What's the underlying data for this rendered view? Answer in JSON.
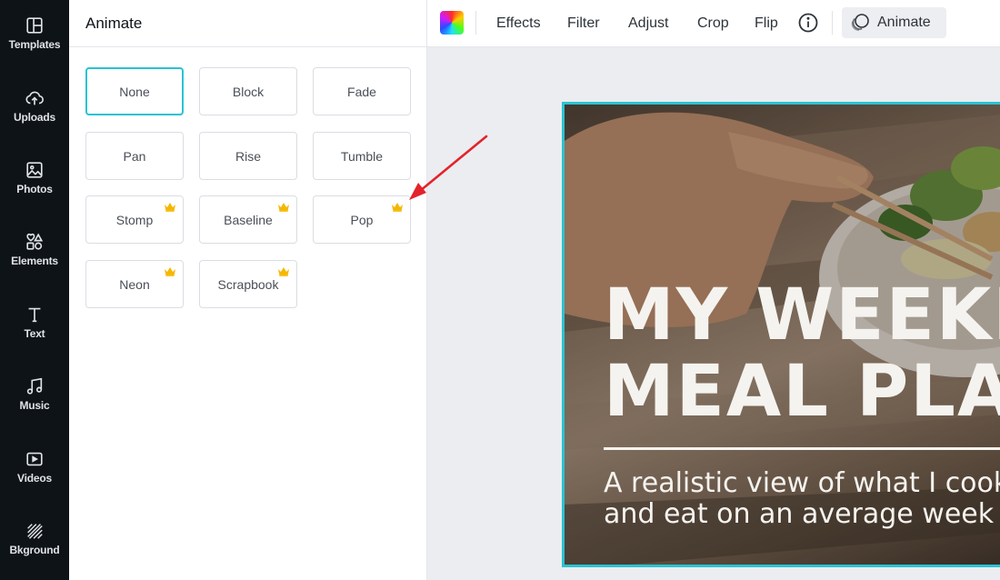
{
  "sidebar": {
    "items": [
      {
        "label": "Templates",
        "icon": "templates-icon"
      },
      {
        "label": "Uploads",
        "icon": "upload-cloud-icon"
      },
      {
        "label": "Photos",
        "icon": "image-icon"
      },
      {
        "label": "Elements",
        "icon": "shapes-icon"
      },
      {
        "label": "Text",
        "icon": "text-t-icon"
      },
      {
        "label": "Music",
        "icon": "music-note-icon"
      },
      {
        "label": "Videos",
        "icon": "video-play-icon"
      },
      {
        "label": "Bkground",
        "icon": "background-hatch-icon"
      }
    ]
  },
  "panel": {
    "title": "Animate",
    "animations": [
      {
        "label": "None",
        "selected": true,
        "premium": false
      },
      {
        "label": "Block",
        "selected": false,
        "premium": false
      },
      {
        "label": "Fade",
        "selected": false,
        "premium": false
      },
      {
        "label": "Pan",
        "selected": false,
        "premium": false
      },
      {
        "label": "Rise",
        "selected": false,
        "premium": false
      },
      {
        "label": "Tumble",
        "selected": false,
        "premium": false
      },
      {
        "label": "Stomp",
        "selected": false,
        "premium": true
      },
      {
        "label": "Baseline",
        "selected": false,
        "premium": true
      },
      {
        "label": "Pop",
        "selected": false,
        "premium": true
      },
      {
        "label": "Neon",
        "selected": false,
        "premium": true
      },
      {
        "label": "Scrapbook",
        "selected": false,
        "premium": true
      }
    ]
  },
  "toolbar": {
    "effects": "Effects",
    "filter": "Filter",
    "adjust": "Adjust",
    "crop": "Crop",
    "flip": "Flip",
    "animate": "Animate"
  },
  "canvas": {
    "headline_line1": "MY WEEKLY",
    "headline_line2": "MEAL PLAN",
    "subline_line1": "A realistic view of what I cook",
    "subline_line2": "and eat on an average week"
  },
  "colors": {
    "accent": "#2ac3d2",
    "crown": "#f5b700",
    "annotation": "#e3232b",
    "rail_bg": "#0e1318"
  }
}
